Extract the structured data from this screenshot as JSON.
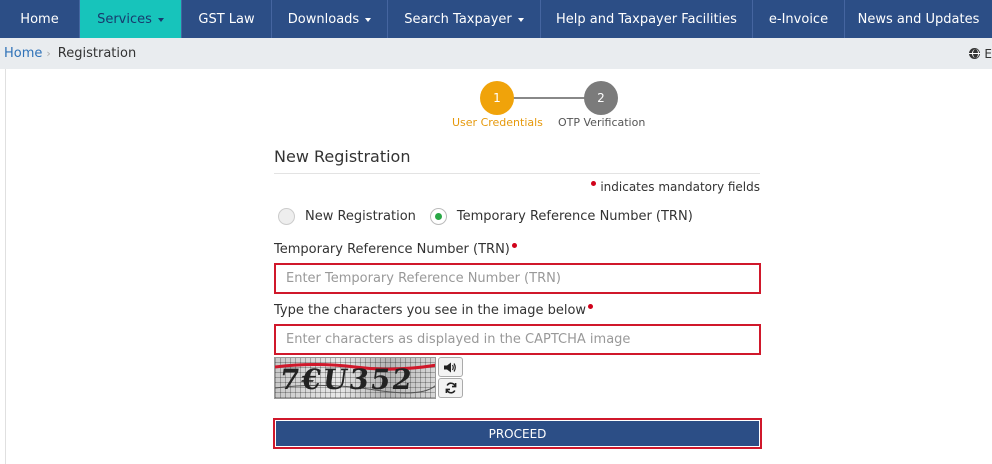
{
  "nav": {
    "items": [
      {
        "label": "Home",
        "dropdown": false,
        "active": false
      },
      {
        "label": "Services",
        "dropdown": true,
        "active": true
      },
      {
        "label": "GST Law",
        "dropdown": false,
        "active": false
      },
      {
        "label": "Downloads",
        "dropdown": true,
        "active": false
      },
      {
        "label": "Search Taxpayer",
        "dropdown": true,
        "active": false
      },
      {
        "label": "Help and Taxpayer Facilities",
        "dropdown": false,
        "active": false
      },
      {
        "label": "e-Invoice",
        "dropdown": false,
        "active": false
      },
      {
        "label": "News and Updates",
        "dropdown": false,
        "active": false
      }
    ]
  },
  "breadcrumb": {
    "home": "Home",
    "current": "Registration",
    "language": "E"
  },
  "stepper": {
    "steps": [
      {
        "number": "1",
        "label": "User Credentials",
        "state": "active"
      },
      {
        "number": "2",
        "label": "OTP Verification",
        "state": "pending"
      }
    ]
  },
  "form": {
    "title": "New Registration",
    "mandatory_note": "indicates mandatory fields",
    "radios": [
      {
        "label": "New Registration",
        "checked": false
      },
      {
        "label": "Temporary Reference Number (TRN)",
        "checked": true
      }
    ],
    "trn_label": "Temporary Reference Number (TRN)",
    "trn_placeholder": "Enter Temporary Reference Number (TRN)",
    "trn_value": "",
    "captcha_label": "Type the characters you see in the image below",
    "captcha_placeholder": "Enter characters as displayed in the CAPTCHA image",
    "captcha_value": "",
    "captcha_text": "7€U352",
    "proceed_label": "PROCEED"
  },
  "colors": {
    "nav_bg": "#2c4e86",
    "nav_active": "#17c4bb",
    "step_active": "#f0a30a",
    "step_pending": "#7b7b7b",
    "required": "#d0021b",
    "error_border": "#d0182b",
    "radio_checked": "#28a745"
  },
  "icons": [
    "globe-icon",
    "chevron-right-icon",
    "speaker-icon",
    "refresh-icon"
  ]
}
